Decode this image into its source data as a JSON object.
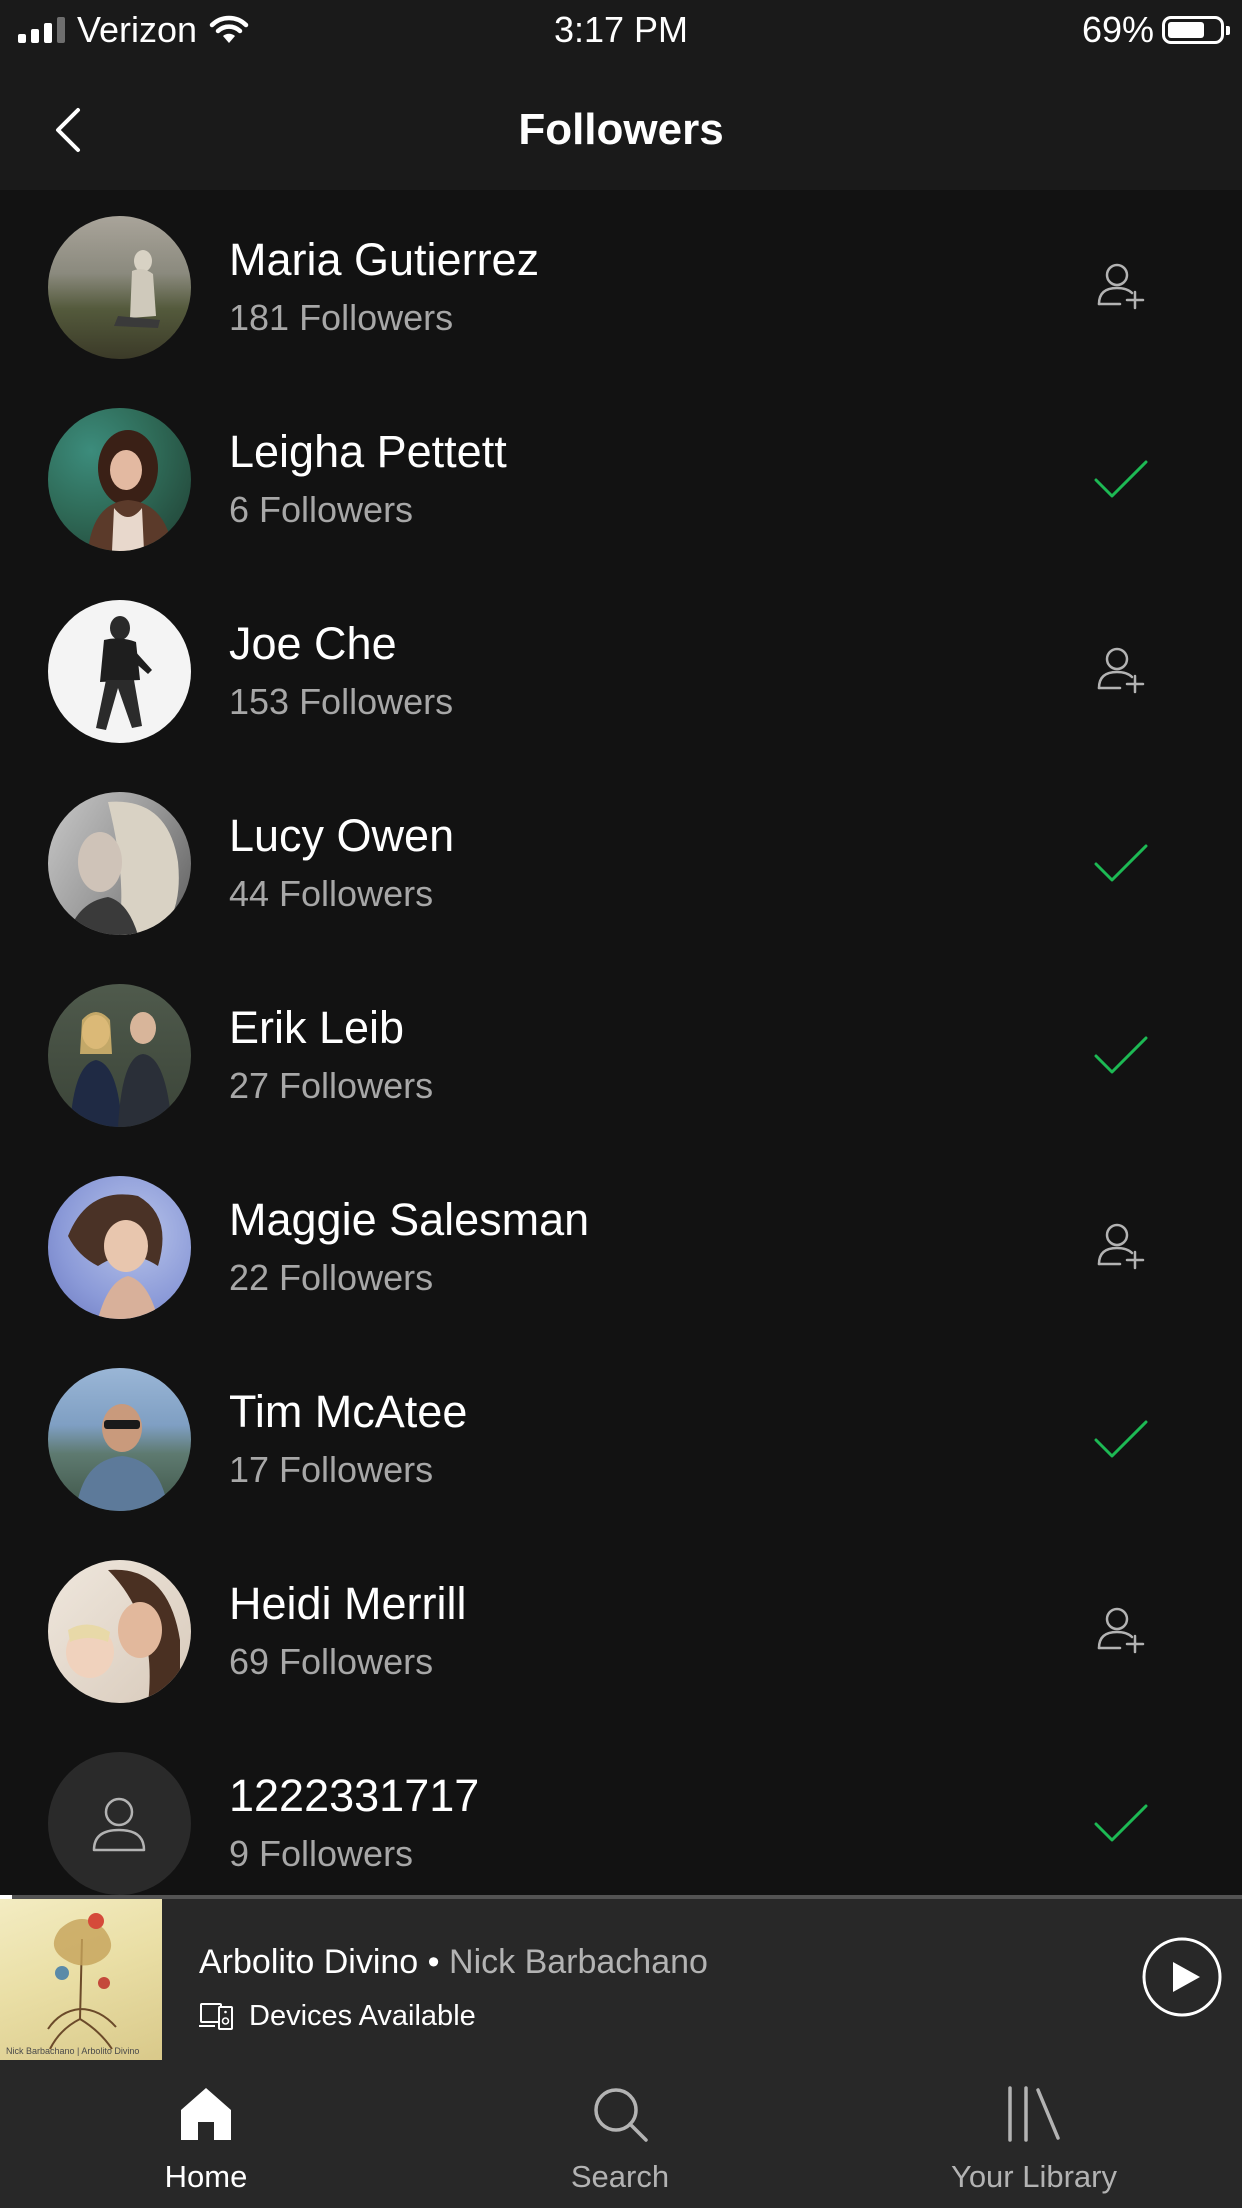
{
  "status_bar": {
    "carrier": "Verizon",
    "time": "3:17 PM",
    "battery": "69%"
  },
  "header": {
    "title": "Followers",
    "back_icon": "chevron-left-icon"
  },
  "followers": [
    {
      "name": "Maria Gutierrez",
      "followers": "181 Followers",
      "following": false
    },
    {
      "name": "Leigha Pettett",
      "followers": "6 Followers",
      "following": true
    },
    {
      "name": "Joe Che",
      "followers": "153 Followers",
      "following": false
    },
    {
      "name": "Lucy Owen",
      "followers": "44 Followers",
      "following": true
    },
    {
      "name": "Erik Leib",
      "followers": "27 Followers",
      "following": true
    },
    {
      "name": "Maggie Salesman",
      "followers": "22 Followers",
      "following": false
    },
    {
      "name": "Tim McAtee",
      "followers": "17 Followers",
      "following": true
    },
    {
      "name": "Heidi Merrill",
      "followers": "69 Followers",
      "following": false
    },
    {
      "name": "1222331717",
      "followers": "9 Followers",
      "following": true
    }
  ],
  "now_playing": {
    "title": "Arbolito Divino",
    "separator": " • ",
    "artist": "Nick Barbachano",
    "devices": "Devices Available",
    "album_caption": "Nick Barbachano | Arbolito Divino",
    "progress": 0.01
  },
  "tabs": [
    {
      "label": "Home",
      "icon": "home-icon",
      "active": true
    },
    {
      "label": "Search",
      "icon": "search-icon",
      "active": false
    },
    {
      "label": "Your Library",
      "icon": "library-icon",
      "active": false
    }
  ],
  "colors": {
    "background": "#121212",
    "accent_green": "#1db954",
    "secondary_text": "#a7a7a7"
  }
}
